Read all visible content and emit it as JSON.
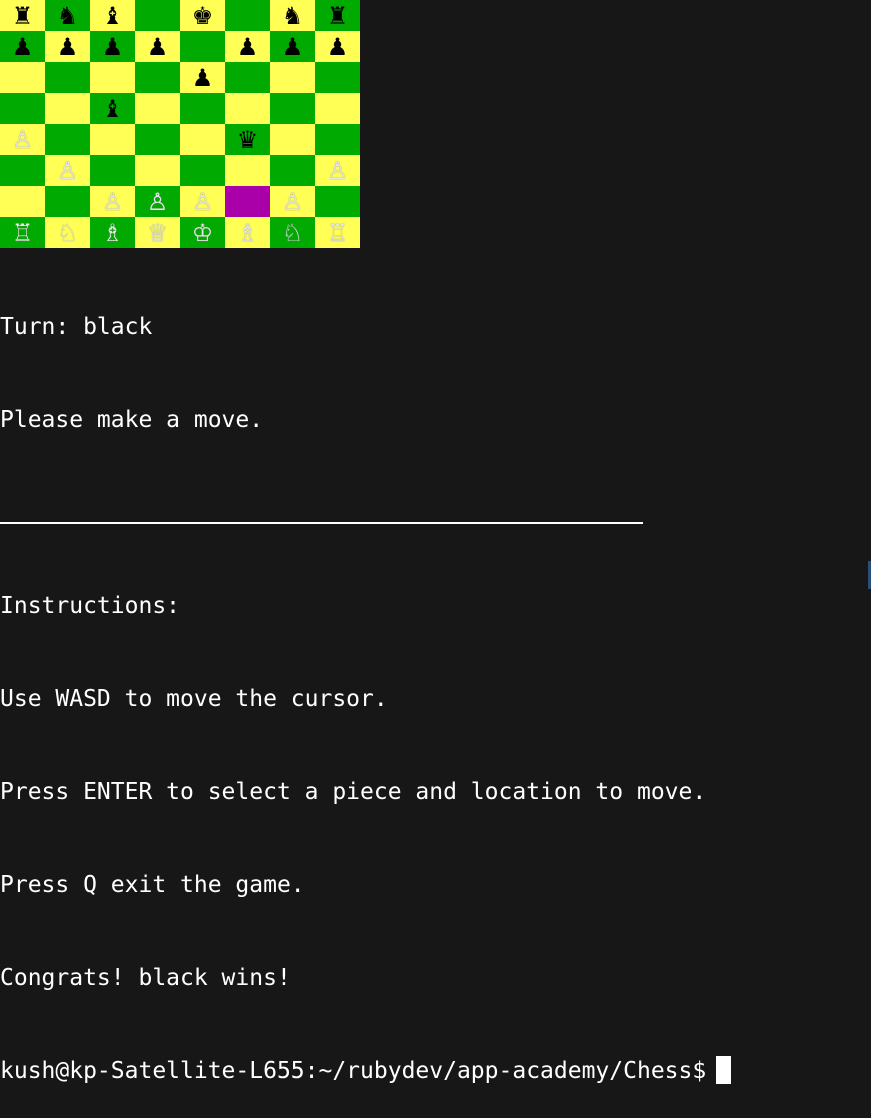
{
  "colors": {
    "background": "#171717",
    "text": "#ffffff",
    "light_square": "#ffff55",
    "dark_square": "#00aa00",
    "cursor_square": "#aa00aa",
    "black_piece": "#000000",
    "white_piece": "#e6e6e6"
  },
  "board": {
    "cursor": [
      6,
      5
    ],
    "rows": [
      [
        [
          "bR",
          "rook-icon",
          "black",
          "♜"
        ],
        [
          "bN",
          "knight-icon",
          "black",
          "♞"
        ],
        [
          "bB",
          "bishop-icon",
          "black",
          "♝"
        ],
        null,
        [
          "bK",
          "king-icon",
          "black",
          "♚"
        ],
        null,
        [
          "bN",
          "knight-icon",
          "black",
          "♞"
        ],
        [
          "bR",
          "rook-icon",
          "black",
          "♜"
        ]
      ],
      [
        [
          "bP",
          "pawn-icon",
          "black",
          "♟"
        ],
        [
          "bP",
          "pawn-icon",
          "black",
          "♟"
        ],
        [
          "bP",
          "pawn-icon",
          "black",
          "♟"
        ],
        [
          "bP",
          "pawn-icon",
          "black",
          "♟"
        ],
        null,
        [
          "bP",
          "pawn-icon",
          "black",
          "♟"
        ],
        [
          "bP",
          "pawn-icon",
          "black",
          "♟"
        ],
        [
          "bP",
          "pawn-icon",
          "black",
          "♟"
        ]
      ],
      [
        null,
        null,
        null,
        null,
        [
          "bP",
          "pawn-icon",
          "black",
          "♟"
        ],
        null,
        null,
        null
      ],
      [
        null,
        null,
        [
          "bB",
          "bishop-icon",
          "black",
          "♝"
        ],
        null,
        null,
        null,
        null,
        null
      ],
      [
        [
          "wP",
          "pawn-icon",
          "white",
          "♙"
        ],
        null,
        null,
        null,
        null,
        [
          "bQ",
          "queen-icon",
          "black",
          "♛"
        ],
        null,
        null
      ],
      [
        null,
        [
          "wP",
          "pawn-icon",
          "white",
          "♙"
        ],
        null,
        null,
        null,
        null,
        null,
        [
          "wP",
          "pawn-icon",
          "white",
          "♙"
        ]
      ],
      [
        null,
        null,
        [
          "wP",
          "pawn-icon",
          "white",
          "♙"
        ],
        [
          "wP",
          "pawn-icon",
          "white",
          "♙"
        ],
        [
          "wP",
          "pawn-icon",
          "white",
          "♙"
        ],
        null,
        [
          "wP",
          "pawn-icon",
          "white",
          "♙"
        ],
        null
      ],
      [
        [
          "wR",
          "rook-icon",
          "white",
          "♖"
        ],
        [
          "wN",
          "knight-icon",
          "white",
          "♘"
        ],
        [
          "wB",
          "bishop-icon",
          "white",
          "♗"
        ],
        [
          "wQ",
          "queen-icon",
          "white",
          "♕"
        ],
        [
          "wK",
          "king-icon",
          "white",
          "♔"
        ],
        [
          "wB",
          "bishop-icon",
          "white",
          "♗"
        ],
        [
          "wN",
          "knight-icon",
          "white",
          "♘"
        ],
        [
          "wR",
          "rook-icon",
          "white",
          "♖"
        ]
      ]
    ]
  },
  "terminal": {
    "turn": "Turn: black",
    "prompt_message": "Please make a move.",
    "instructions_header": "Instructions:",
    "instructions": [
      "Use WASD to move the cursor.",
      "Press ENTER to select a piece and location to move.",
      "Press Q exit the game."
    ],
    "result": "Congrats! black wins!",
    "shell_prompt": "kush@kp-Satellite-L655:~/rubydev/app-academy/Chess$"
  }
}
